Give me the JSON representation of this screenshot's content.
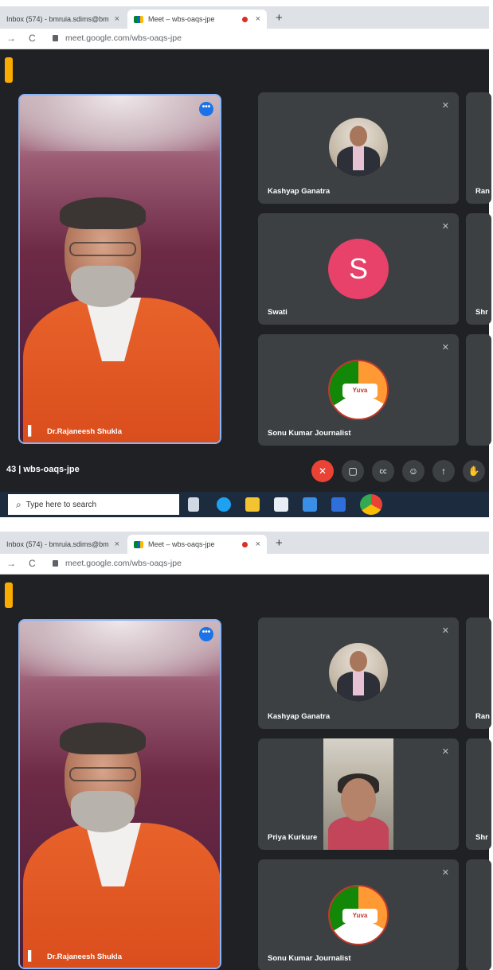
{
  "browser": {
    "tab_inbox": "Inbox (574) - bmruia.sdims@bm",
    "tab_meet": "Meet – wbs-oaqs-jpe",
    "close_glyph": "×",
    "new_tab_glyph": "+",
    "back_glyph": "→",
    "reload_glyph": "C",
    "url": "meet.google.com/wbs-oaqs-jpe"
  },
  "shot1": {
    "main_name": "Dr.Rajaneesh Shukla",
    "tiles": [
      "Kashyap Ganatra",
      "Swati",
      "Sonu Kumar Journalist"
    ],
    "side_tiles": [
      "Ran",
      "Shr"
    ],
    "avatar_letter": "S",
    "meeting_code": "43 | wbs-oaqs-jpe",
    "search_placeholder": "Type here to search"
  },
  "shot2": {
    "main_name": "Dr.Rajaneesh Shukla",
    "tiles": [
      "Kashyap Ganatra",
      "Priya Kurkure",
      "Sonu Kumar Journalist"
    ],
    "side_tiles": [
      "Ran",
      "Shr"
    ]
  },
  "logo_text": "Yuva",
  "icons": {
    "more": "•••",
    "pin": "▌",
    "muted_mic": "✕",
    "mic": "✕",
    "camera": "▢",
    "cc": "cc",
    "emoji": "☺",
    "present": "↑",
    "hand": "✋",
    "search": "⌕"
  }
}
